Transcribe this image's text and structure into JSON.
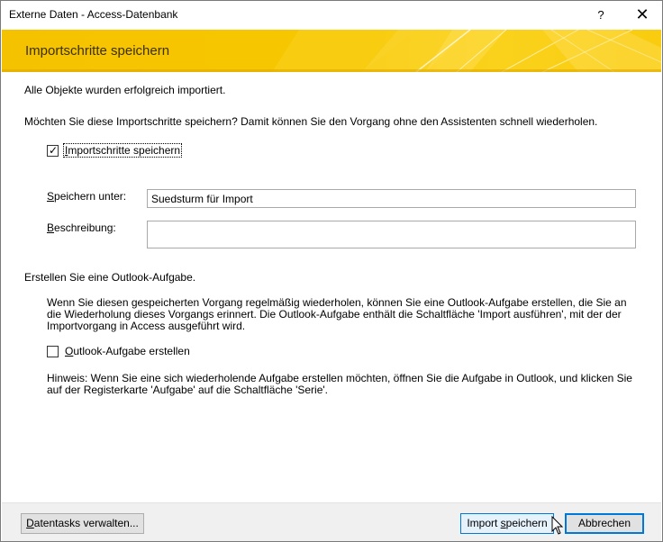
{
  "window": {
    "title": "Externe Daten - Access-Datenbank",
    "help_label": "?",
    "close_label": "✕"
  },
  "banner": {
    "title": "Importschritte speichern"
  },
  "main": {
    "success_message": "Alle Objekte wurden erfolgreich importiert.",
    "question": "Möchten Sie diese Importschritte speichern? Damit können Sie den Vorgang ohne den Assistenten schnell wiederholen.",
    "save_steps": {
      "checked": true,
      "label_underlined": "I",
      "label_rest": "mportschritte speichern"
    },
    "save_as": {
      "label_underlined": "S",
      "label_rest": "peichern unter:",
      "value": "Suedsturm für Import"
    },
    "description": {
      "label_underlined": "B",
      "label_rest": "eschreibung:",
      "value": ""
    },
    "outlook_section_title": "Erstellen Sie eine Outlook-Aufgabe.",
    "outlook_info": "Wenn Sie diesen gespeicherten Vorgang regelmäßig wiederholen, können Sie eine Outlook-Aufgabe erstellen, die Sie an die Wiederholung dieses Vorgangs erinnert. Die Outlook-Aufgabe enthält die Schaltfläche 'Import ausführen', mit der der Importvorgang in Access ausgeführt wird.",
    "outlook_task": {
      "checked": false,
      "label_underlined": "O",
      "label_rest": "utlook-Aufgabe erstellen"
    },
    "hint": "Hinweis: Wenn Sie eine sich wiederholende Aufgabe erstellen möchten, öffnen Sie die Aufgabe in Outlook, und klicken Sie auf der Registerkarte 'Aufgabe' auf die Schaltfläche 'Serie'."
  },
  "footer": {
    "manage_button": {
      "underlined": "D",
      "rest": "atentasks verwalten..."
    },
    "save_import_button": {
      "underlined": "",
      "prefix": "Import ",
      "u": "s",
      "rest": "peichern"
    },
    "cancel_button": "Abbrechen"
  },
  "colors": {
    "banner_yellow": "#f5c200",
    "accent_blue": "#0078d7",
    "footer_bg": "#f0f0f0"
  }
}
